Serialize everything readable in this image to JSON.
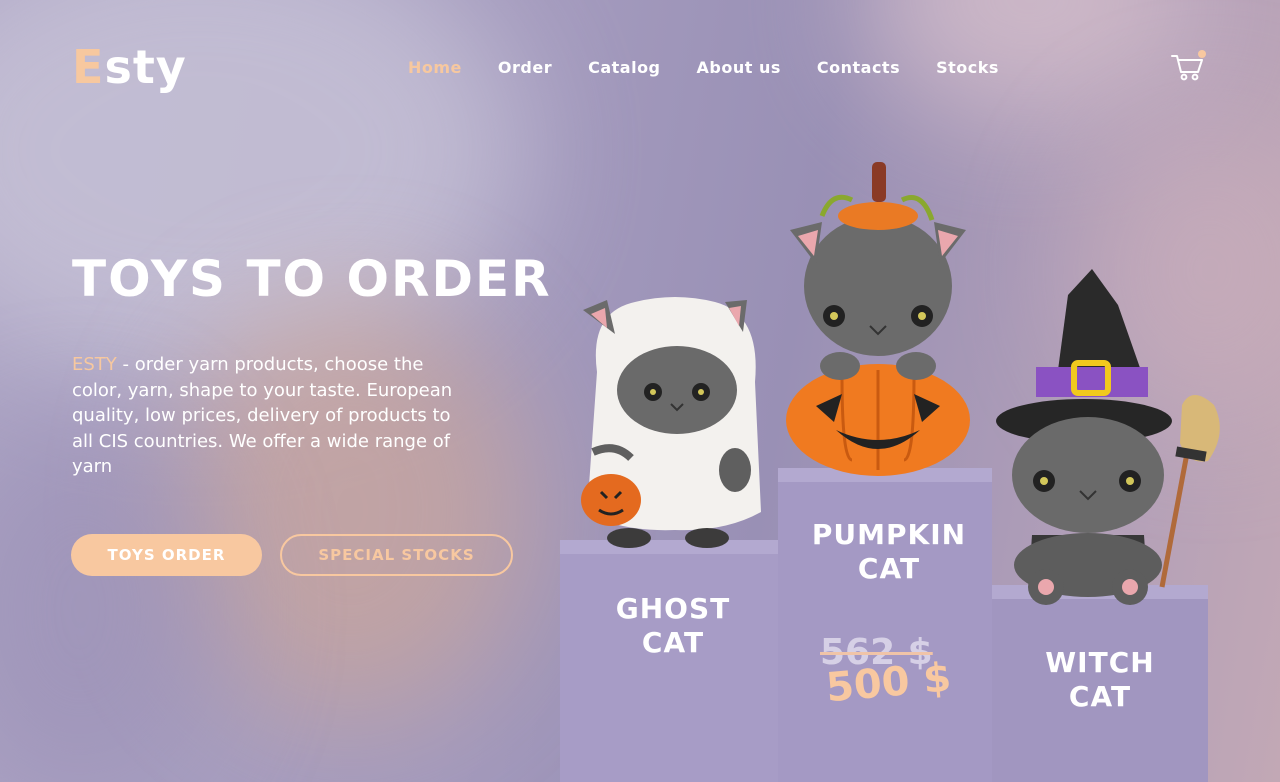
{
  "brand": {
    "logo_first": "E",
    "logo_rest": "sty"
  },
  "nav": {
    "items": [
      {
        "label": "Home",
        "active": true
      },
      {
        "label": "Order"
      },
      {
        "label": "Catalog"
      },
      {
        "label": "About us"
      },
      {
        "label": "Contacts"
      },
      {
        "label": "Stocks"
      }
    ]
  },
  "cart": {
    "icon": "cart-icon",
    "badge": "notification-dot"
  },
  "hero": {
    "title": "TOYS TO ORDER",
    "desc_brand": "ESTY",
    "desc_rest": " - order yarn products, choose the color, yarn, shape to your taste. European quality, low prices, delivery of products to all CIS countries.  We offer a wide range of yarn",
    "primary_button": "TOYS ORDER",
    "secondary_button": "SPECIAL STOCKS"
  },
  "products": [
    {
      "name_line1": "GHOST",
      "name_line2": "CAT"
    },
    {
      "name_line1": "PUMPKIN",
      "name_line2": "CAT",
      "old_price": "562 $",
      "new_price": "500 $"
    },
    {
      "name_line1": "WITCH",
      "name_line2": "CAT"
    }
  ],
  "colors": {
    "accent": "#f8c8a0",
    "background": "#9c93b8",
    "text": "#ffffff"
  }
}
